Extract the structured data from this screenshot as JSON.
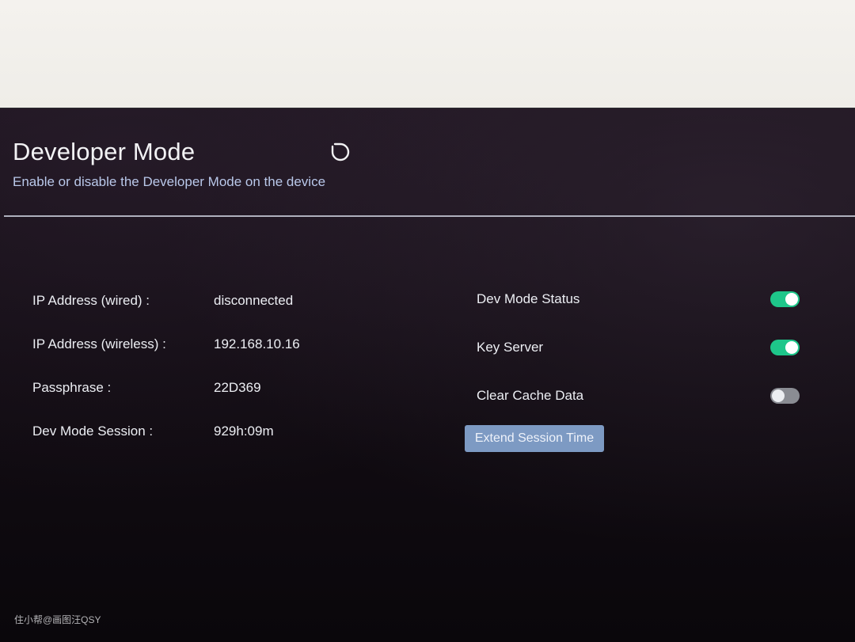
{
  "header": {
    "title": "Developer Mode",
    "subtitle": "Enable or disable the Developer Mode on the device",
    "power_icon": "power-icon"
  },
  "info": [
    {
      "label": "IP Address (wired) :",
      "value": "disconnected"
    },
    {
      "label": "IP Address (wireless) :",
      "value": "192.168.10.16"
    },
    {
      "label": "Passphrase :",
      "value": "22D369"
    },
    {
      "label": "Dev Mode Session :",
      "value": "929h:09m"
    }
  ],
  "settings": [
    {
      "label": "Dev Mode Status",
      "enabled": true
    },
    {
      "label": "Key Server",
      "enabled": true
    },
    {
      "label": "Clear Cache Data",
      "enabled": false
    }
  ],
  "extend_button_label": "Extend Session Time",
  "watermark": "住小帮@画图汪QSY",
  "colors": {
    "toggle_on": "#1ec68a",
    "toggle_off": "#8a8c93",
    "button": "#7d9ac3",
    "subtitle": "#b9c8ea"
  }
}
